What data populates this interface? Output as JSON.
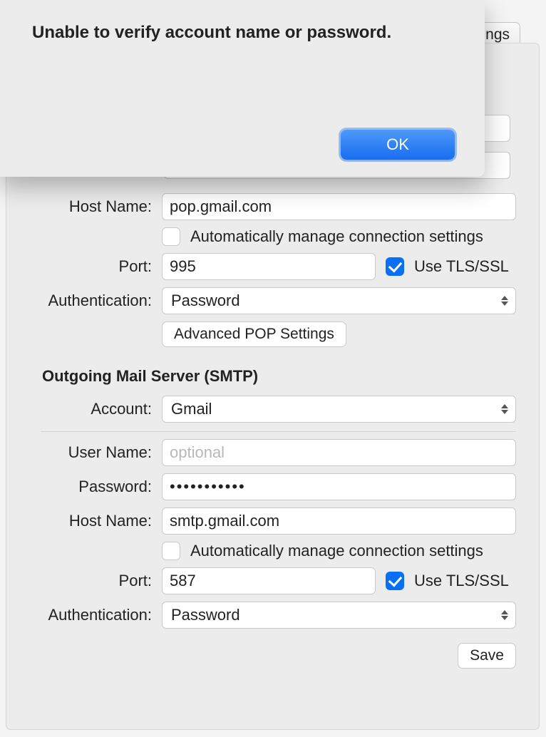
{
  "tab_stub_label": "ngs",
  "alert": {
    "title": "Unable to verify account name or password.",
    "ok_label": "OK"
  },
  "incoming": {
    "host_label": "Host Name:",
    "host_value": "pop.gmail.com",
    "auto_label": "Automatically manage connection settings",
    "auto_checked": false,
    "port_label": "Port:",
    "port_value": "995",
    "tls_label": "Use TLS/SSL",
    "tls_checked": true,
    "auth_label": "Authentication:",
    "auth_value": "Password",
    "advanced_label": "Advanced POP Settings"
  },
  "smtp_section_title": "Outgoing Mail Server (SMTP)",
  "smtp": {
    "account_label": "Account:",
    "account_value": "Gmail",
    "user_label": "User Name:",
    "user_placeholder": "optional",
    "user_value": "",
    "password_label": "Password:",
    "password_value": "•••••••••••",
    "host_label": "Host Name:",
    "host_value": "smtp.gmail.com",
    "auto_label": "Automatically manage connection settings",
    "auto_checked": false,
    "port_label": "Port:",
    "port_value": "587",
    "tls_label": "Use TLS/SSL",
    "tls_checked": true,
    "auth_label": "Authentication:",
    "auth_value": "Password"
  },
  "save_label": "Save"
}
